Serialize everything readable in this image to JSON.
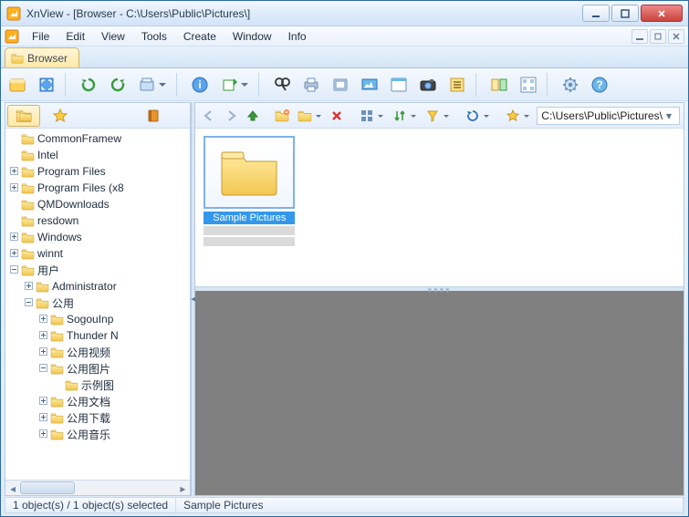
{
  "window": {
    "title": "XnView - [Browser - C:\\Users\\Public\\Pictures\\]"
  },
  "menu": {
    "items": [
      "File",
      "Edit",
      "View",
      "Tools",
      "Create",
      "Window",
      "Info"
    ]
  },
  "doc_tab": {
    "label": "Browser"
  },
  "address": {
    "path": "C:\\Users\\Public\\Pictures\\"
  },
  "tree": {
    "items": [
      {
        "indent": 2,
        "twisty": "",
        "label": "CommonFramew"
      },
      {
        "indent": 2,
        "twisty": "",
        "label": "Intel"
      },
      {
        "indent": 2,
        "twisty": "+",
        "label": "Program Files"
      },
      {
        "indent": 2,
        "twisty": "+",
        "label": "Program Files (x8"
      },
      {
        "indent": 2,
        "twisty": "",
        "label": "QMDownloads"
      },
      {
        "indent": 2,
        "twisty": "",
        "label": "resdown"
      },
      {
        "indent": 2,
        "twisty": "+",
        "label": "Windows"
      },
      {
        "indent": 2,
        "twisty": "+",
        "label": "winnt"
      },
      {
        "indent": 2,
        "twisty": "-",
        "label": "用户"
      },
      {
        "indent": 3,
        "twisty": "+",
        "label": "Administrator"
      },
      {
        "indent": 3,
        "twisty": "-",
        "label": "公用"
      },
      {
        "indent": 4,
        "twisty": "+",
        "label": "SogouInp"
      },
      {
        "indent": 4,
        "twisty": "+",
        "label": "Thunder N"
      },
      {
        "indent": 4,
        "twisty": "+",
        "label": "公用视频"
      },
      {
        "indent": 4,
        "twisty": "-",
        "label": "公用图片"
      },
      {
        "indent": 5,
        "twisty": "",
        "label": "示例图"
      },
      {
        "indent": 4,
        "twisty": "+",
        "label": "公用文档"
      },
      {
        "indent": 4,
        "twisty": "+",
        "label": "公用下载"
      },
      {
        "indent": 4,
        "twisty": "+",
        "label": "公用音乐"
      }
    ]
  },
  "thumbnail": {
    "label": "Sample Pictures"
  },
  "status": {
    "left": "1 object(s) / 1 object(s) selected",
    "right": "Sample Pictures"
  }
}
